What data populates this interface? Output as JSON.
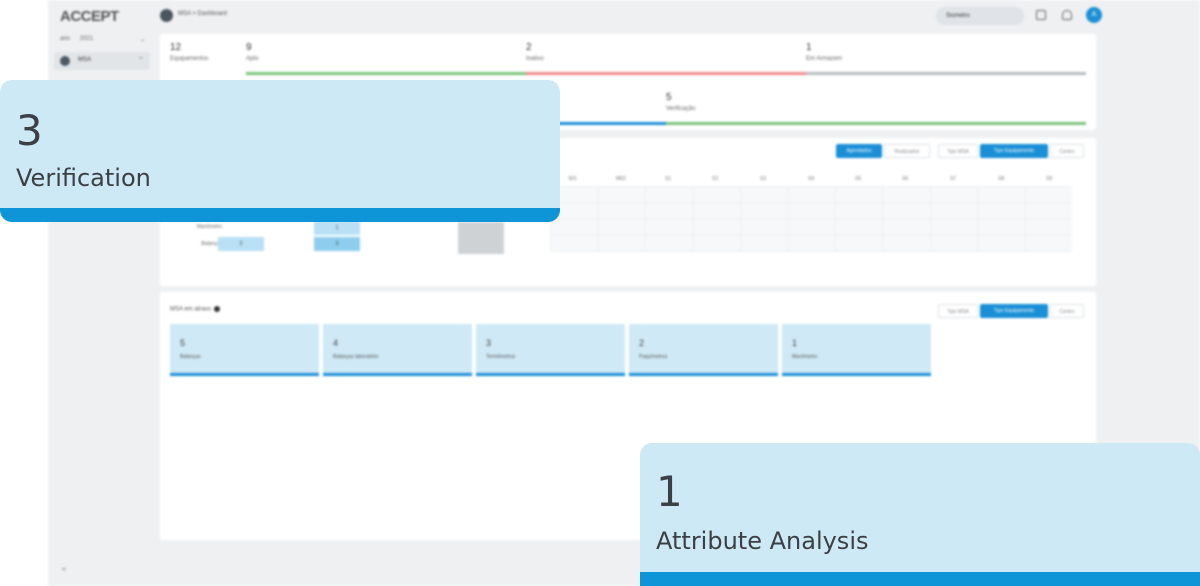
{
  "app": {
    "logo": "ACCEPT",
    "sidebar": {
      "year_label": "ano",
      "year_value": "2021",
      "items": [
        {
          "label": "MSA"
        }
      ],
      "footer": "«"
    },
    "breadcrumb": "MSA  >  Dashboard",
    "user_name": "Sismetro",
    "avatar_letter": "A",
    "stats": [
      {
        "value": "12",
        "label": "Equipamentos"
      },
      {
        "value": "9",
        "label": "Apto"
      },
      {
        "value": "2",
        "label": "Inativo"
      },
      {
        "value": "1",
        "label": "Em Armazem"
      },
      {
        "value": "5",
        "label": "Verificação"
      }
    ],
    "calendar": {
      "toggle1": [
        "Agendados",
        "Realizados"
      ],
      "toggle2": [
        "Tipo MSA",
        "Tipo Equipamento",
        "Centro"
      ],
      "columns": [
        "S01",
        "M02",
        "S1",
        "S2",
        "S3",
        "S4",
        "S5",
        "S6",
        "S7",
        "S8",
        "S9"
      ],
      "rows": [
        {
          "label": "Manômetro",
          "cells": [
            {
              "col": "c2",
              "value": "1"
            }
          ]
        },
        {
          "label": "Balanças",
          "cells": [
            {
              "col": "c0",
              "value": "2"
            },
            {
              "col": "c2",
              "value": "3"
            }
          ]
        }
      ]
    },
    "late": {
      "title": "MSA em atraso",
      "toggle": [
        "Tipo MSA",
        "Tipo Equipamento",
        "Centro"
      ],
      "tiles": [
        {
          "value": "5",
          "label": "Balanças"
        },
        {
          "value": "4",
          "label": "Balanças laboratório"
        },
        {
          "value": "3",
          "label": "Termômetros"
        },
        {
          "value": "2",
          "label": "Paquímetros"
        },
        {
          "value": "1",
          "label": "Manômetro"
        }
      ]
    }
  },
  "callouts": [
    {
      "value": "3",
      "label": "Verification"
    },
    {
      "value": "1",
      "label": "Attribute Analysis"
    }
  ],
  "colors": {
    "accent": "#0e95d8",
    "callout_bg": "#cde9f5",
    "green": "#7cc47a",
    "red": "#f08a8a",
    "grey": "#b9bcbf"
  }
}
